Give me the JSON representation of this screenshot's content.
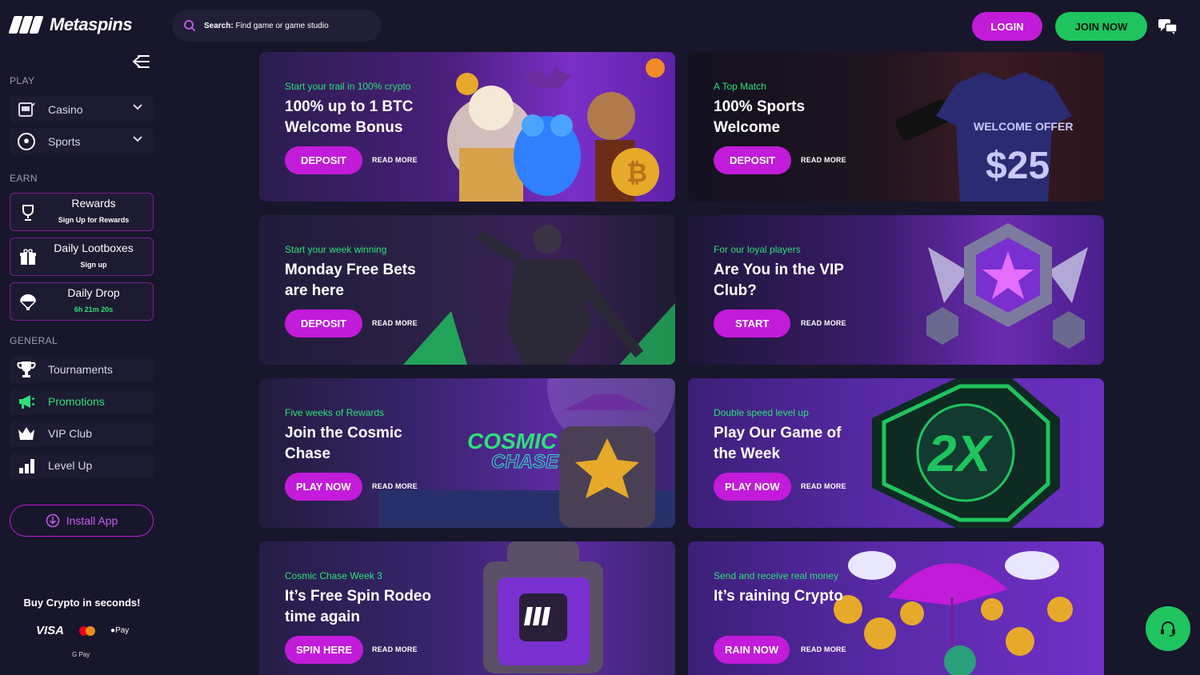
{
  "brand": {
    "name": "Metaspins"
  },
  "search": {
    "label": "Search:",
    "placeholder": "Find game or game studio"
  },
  "header": {
    "login": "LOGIN",
    "join": "JOIN NOW"
  },
  "sidebar": {
    "play_label": "PLAY",
    "play": [
      {
        "label": "Casino"
      },
      {
        "label": "Sports"
      }
    ],
    "earn_label": "EARN",
    "earn": [
      {
        "title": "Rewards",
        "sub": "Sign Up for Rewards"
      },
      {
        "title": "Daily Lootboxes",
        "sub": "Sign up"
      },
      {
        "title": "Daily Drop",
        "sub": "6h 21m 20s"
      }
    ],
    "general_label": "GENERAL",
    "general": [
      {
        "label": "Tournaments"
      },
      {
        "label": "Promotions"
      },
      {
        "label": "VIP Club"
      },
      {
        "label": "Level Up"
      }
    ],
    "install": "Install App",
    "buy_crypto": "Buy Crypto in seconds!",
    "payments": {
      "visa": "VISA",
      "apple": "Pay",
      "google": "G Pay"
    }
  },
  "promos": [
    {
      "sub": "Start your trail in 100% crypto",
      "title": "100% up to 1 BTC Welcome Bonus",
      "cta": "DEPOSIT",
      "more": "READ MORE"
    },
    {
      "sub": "A Top Match",
      "title": "100% Sports Welcome",
      "cta": "DEPOSIT",
      "more": "READ MORE",
      "art_text1": "WELCOME OFFER",
      "art_text2": "$25"
    },
    {
      "sub": "Start your week winning",
      "title": "Monday Free Bets are here",
      "cta": "DEPOSIT",
      "more": "READ MORE"
    },
    {
      "sub": "For our loyal players",
      "title": "Are You in the VIP Club?",
      "cta": "START",
      "more": "READ MORE"
    },
    {
      "sub": "Five weeks of Rewards",
      "title": "Join the Cosmic Chase",
      "cta": "PLAY NOW",
      "more": "READ MORE",
      "art_text1": "COSMIC",
      "art_text2": "CHASE"
    },
    {
      "sub": "Double speed level up",
      "title": "Play Our Game of the Week",
      "cta": "PLAY NOW",
      "more": "READ MORE",
      "art_text1": "2X"
    },
    {
      "sub": "Cosmic Chase Week 3",
      "title": "It’s Free Spin Rodeo time again",
      "cta": "SPIN HERE",
      "more": "READ MORE"
    },
    {
      "sub": "Send and receive real money",
      "title": "It’s raining Crypto",
      "cta": "RAIN NOW",
      "more": "READ MORE"
    }
  ],
  "colors": {
    "bg": "#17162a",
    "accent": "#c21bd9",
    "green": "#1fc45e",
    "text_green": "#2ee07a"
  }
}
